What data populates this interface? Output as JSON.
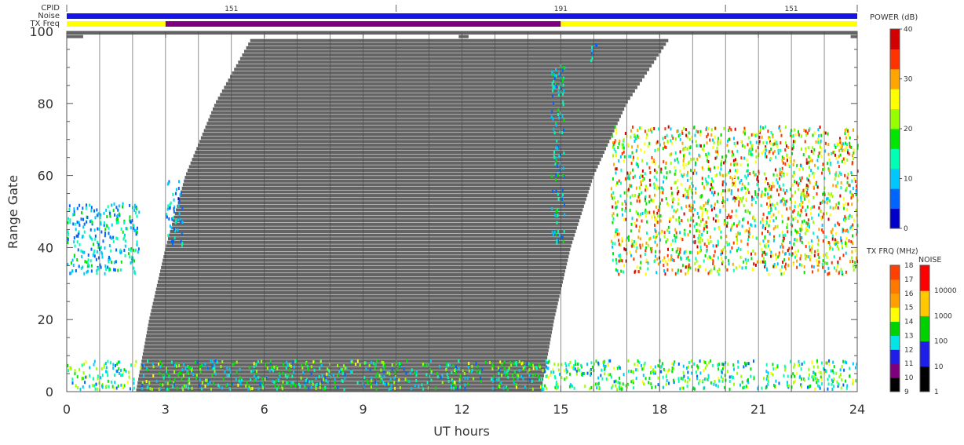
{
  "header": {
    "cpid_label": "CPID",
    "noise_label": "Noise",
    "txfreq_label": "TX Freq",
    "cpid_values": [
      {
        "value": "151",
        "start": 0,
        "end": 10
      },
      {
        "value": "191",
        "start": 10,
        "end": 20
      },
      {
        "value": "151",
        "start": 20,
        "end": 24
      }
    ],
    "tx_segments": [
      {
        "start": 0,
        "end": 3,
        "band": "13-14 MHz",
        "color": "#ffff00"
      },
      {
        "start": 3,
        "end": 15,
        "band": "10-11 MHz",
        "color": "#7f007f"
      },
      {
        "start": 15,
        "end": 24,
        "band": "13-14 MHz",
        "color": "#ffff00"
      }
    ],
    "noise_color": "#1515e6"
  },
  "chart_data": {
    "type": "heatmap",
    "xlabel": "UT hours",
    "ylabel": "Range Gate",
    "xlim": [
      0,
      24
    ],
    "ylim": [
      0,
      100
    ],
    "xticks": [
      "0",
      "3",
      "6",
      "9",
      "12",
      "15",
      "18",
      "21",
      "24"
    ],
    "yticks": [
      "0",
      "20",
      "40",
      "60",
      "80",
      "100"
    ],
    "ground_scatter_color": "#646464",
    "ground_scatter_region": {
      "start_hour": 2.1,
      "end_hour": 14.4,
      "edge_leading": [
        [
          2.1,
          0
        ],
        [
          2.5,
          20
        ],
        [
          3.0,
          40
        ],
        [
          3.6,
          60
        ],
        [
          4.5,
          80
        ],
        [
          5.6,
          98
        ]
      ],
      "edge_trailing": [
        [
          14.4,
          0
        ],
        [
          14.8,
          20
        ],
        [
          15.3,
          40
        ],
        [
          16.0,
          60
        ],
        [
          17.0,
          80
        ],
        [
          18.3,
          98
        ]
      ]
    },
    "scatter_patches": [
      {
        "name": "early-cluster",
        "hours": [
          0.0,
          2.2
        ],
        "gates": [
          32,
          52
        ],
        "peak_db": 18
      },
      {
        "name": "dawn-echo",
        "hours": [
          3.0,
          3.5
        ],
        "gates": [
          40,
          58
        ],
        "peak_db": 15
      },
      {
        "name": "dusk-echo",
        "hours": [
          14.7,
          15.1
        ],
        "gates": [
          40,
          90
        ],
        "peak_db": 18
      },
      {
        "name": "upper-echo",
        "hours": [
          15.9,
          16.1
        ],
        "gates": [
          91,
          98
        ],
        "peak_db": 15
      },
      {
        "name": "evening-band",
        "hours": [
          16.5,
          24.0
        ],
        "gates": [
          32,
          73
        ],
        "peak_db": 38
      },
      {
        "name": "near-range",
        "hours": [
          0.0,
          24.0
        ],
        "gates": [
          0,
          8
        ],
        "peak_db": 25
      }
    ],
    "power_colorbar": {
      "title": "POWER (dB)",
      "range": [
        0,
        40
      ],
      "ticks": [
        "0",
        "10",
        "20",
        "30",
        "40"
      ],
      "colors": [
        "#0000c8",
        "#0064ff",
        "#00c8ff",
        "#00ffb4",
        "#00e600",
        "#96ff00",
        "#ffff00",
        "#ffa500",
        "#ff3200",
        "#d20000"
      ]
    },
    "txfreq_colorbar": {
      "title": "TX FRQ (MHz)",
      "levels": [
        "9",
        "10",
        "11",
        "12",
        "13",
        "14",
        "15",
        "16",
        "17",
        "18"
      ],
      "colors": [
        "#000000",
        "#7f007f",
        "#1e1ee6",
        "#00e6e6",
        "#00d200",
        "#ffff00",
        "#ffa000",
        "#ff7800",
        "#ff4000",
        "#e60000"
      ]
    },
    "noise_colorbar": {
      "title": "NOISE",
      "levels": [
        "1",
        "10",
        "100",
        "1000",
        "10000"
      ],
      "colors": [
        "#000000",
        "#1e1ee6",
        "#00d200",
        "#ffc800",
        "#ff0000"
      ]
    }
  }
}
